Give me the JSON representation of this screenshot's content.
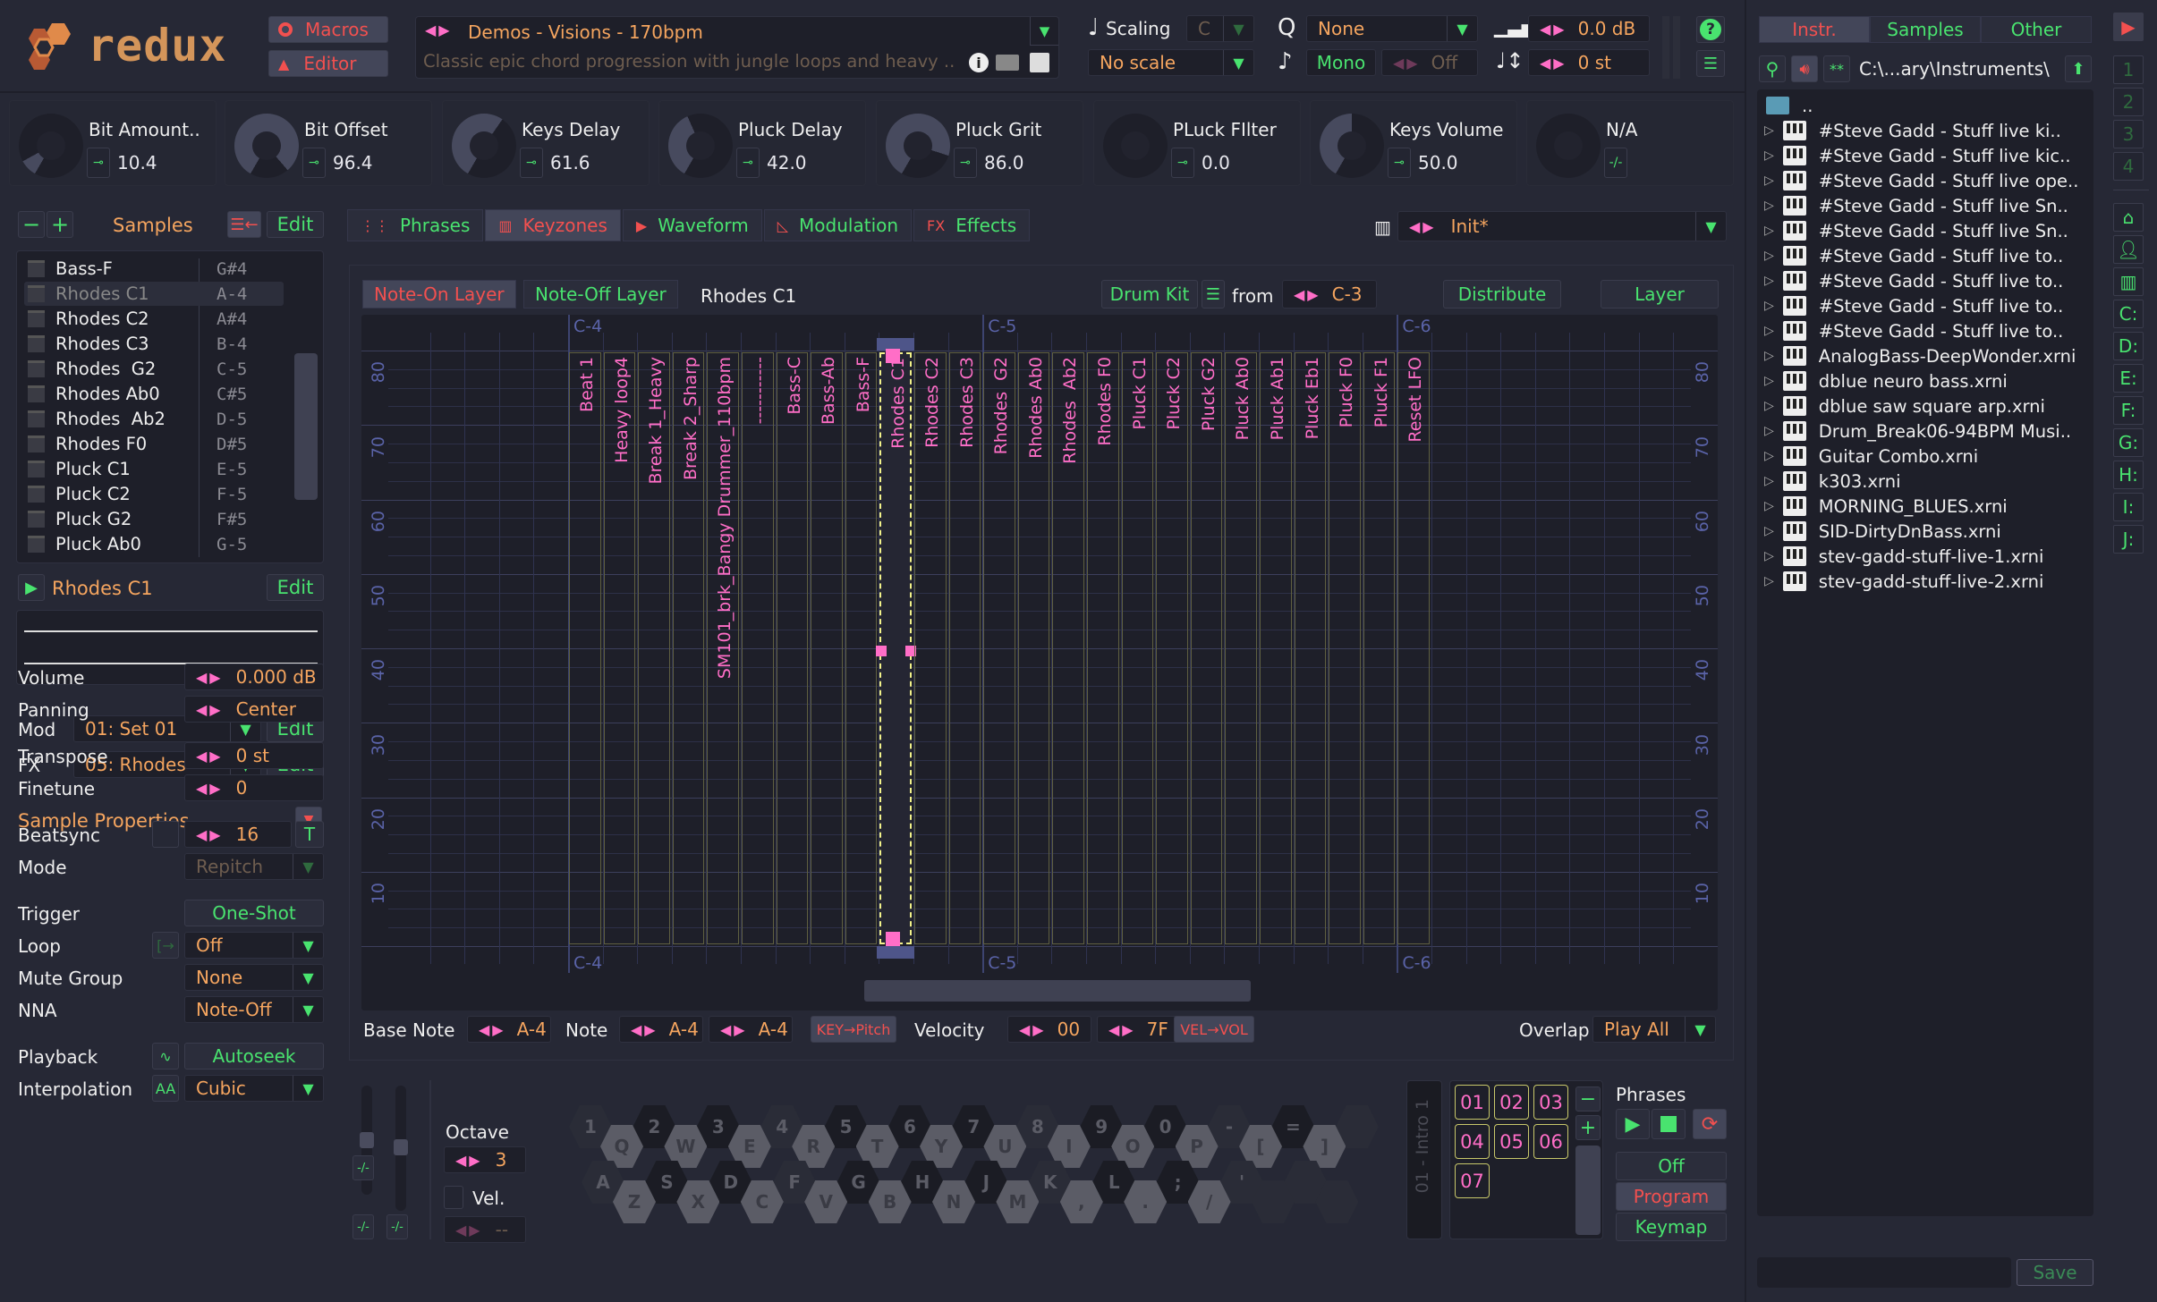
{
  "app": {
    "name": "redux"
  },
  "header": {
    "macros_label": "Macros",
    "editor_label": "Editor",
    "preset_name": "Demos - Visions - 170bpm",
    "preset_description": "Classic epic chord progression with jungle loops and heavy ..",
    "scaling_label": "Scaling",
    "scaling_key": "C",
    "scale_value": "No scale",
    "quantize_value": "None",
    "mono_label": "Mono",
    "glide_value": "Off",
    "volume_value": "0.0 dB",
    "transpose_value": "0 st"
  },
  "macros": [
    {
      "name": "Bit Amount..",
      "value": "10.4",
      "level": 0.104
    },
    {
      "name": "Bit Offset",
      "value": "96.4",
      "level": 0.964
    },
    {
      "name": "Keys Delay",
      "value": "61.6",
      "level": 0.616
    },
    {
      "name": "Pluck Delay",
      "value": "42.0",
      "level": 0.42
    },
    {
      "name": "Pluck Grit",
      "value": "86.0",
      "level": 0.86
    },
    {
      "name": "PLuck FIlter",
      "value": "0.0",
      "level": 0.0
    },
    {
      "name": "Keys Volume",
      "value": "50.0",
      "level": 0.5
    },
    {
      "name": "N/A",
      "value": "",
      "level": 0.0
    }
  ],
  "samples_panel": {
    "title": "Samples",
    "edit_label": "Edit",
    "items": [
      {
        "name": "Bass-F",
        "note": "G#4"
      },
      {
        "name": "Rhodes C1",
        "note": "A-4",
        "selected": true
      },
      {
        "name": "Rhodes C2",
        "note": "A#4"
      },
      {
        "name": "Rhodes C3",
        "note": "B-4"
      },
      {
        "name": "Rhodes  G2",
        "note": "C-5"
      },
      {
        "name": "Rhodes Ab0",
        "note": "C#5"
      },
      {
        "name": "Rhodes  Ab2",
        "note": "D-5"
      },
      {
        "name": "Rhodes F0",
        "note": "D#5"
      },
      {
        "name": "Pluck C1",
        "note": "E-5"
      },
      {
        "name": "Pluck C2",
        "note": "F-5"
      },
      {
        "name": "Pluck G2",
        "note": "F#5"
      },
      {
        "name": "Pluck Ab0",
        "note": "G-5"
      }
    ],
    "current_sample": "Rhodes C1",
    "mod_label": "Mod",
    "mod_value": "01: Set 01",
    "fx_label": "FX",
    "fx_value": "05: Rhodes"
  },
  "sample_properties": {
    "title": "Sample Properties",
    "volume": {
      "label": "Volume",
      "value": "0.000 dB"
    },
    "panning": {
      "label": "Panning",
      "value": "Center"
    },
    "transpose": {
      "label": "Transpose",
      "value": "0 st"
    },
    "finetune": {
      "label": "Finetune",
      "value": "0"
    },
    "beatsync": {
      "label": "Beatsync",
      "value": "16",
      "toggle": "T"
    },
    "mode": {
      "label": "Mode",
      "value": "Repitch"
    },
    "trigger": {
      "label": "Trigger",
      "value": "One-Shot"
    },
    "loop": {
      "label": "Loop",
      "value": "Off"
    },
    "mute_group": {
      "label": "Mute Group",
      "value": "None"
    },
    "nna": {
      "label": "NNA",
      "value": "Note-Off"
    },
    "playback": {
      "label": "Playback",
      "value": "Autoseek"
    },
    "interpolation": {
      "label": "Interpolation",
      "value": "Cubic"
    }
  },
  "main_tabs": [
    {
      "label": "Phrases"
    },
    {
      "label": "Keyzones",
      "active": true
    },
    {
      "label": "Waveform"
    },
    {
      "label": "Modulation"
    },
    {
      "label": "Effects"
    }
  ],
  "preset_selector": {
    "value": "Init*"
  },
  "keyzones": {
    "note_on_layer": "Note-On Layer",
    "note_off_layer": "Note-Off Layer",
    "selected_sample": "Rhodes C1",
    "drum_kit_label": "Drum Kit",
    "from_label": "from",
    "from_value": "C-3",
    "distribute_label": "Distribute",
    "layer_label": "Layer",
    "octave_labels": [
      "C-4",
      "C-5",
      "C-6"
    ],
    "velocity_ticks": [
      "80",
      "70",
      "60",
      "50",
      "40",
      "30",
      "20",
      "10"
    ],
    "zones": [
      "Beat 1",
      "Heavy loop4",
      "Break 1_Heavy",
      "Break 2_Sharp",
      "SM101_brk_Bangy Drummer_110bpm",
      "-----------",
      "Bass-C",
      "Bass-Ab",
      "Bass-F",
      "Rhodes C1",
      "Rhodes C2",
      "Rhodes C3",
      "Rhodes  G2",
      "Rhodes Ab0",
      "Rhodes  Ab2",
      "Rhodes F0",
      "Pluck C1",
      "Pluck C2",
      "Pluck G2",
      "Pluck Ab0",
      "Pluck Ab1",
      "Pluck Eb1",
      "Pluck F0",
      "Pluck F1",
      "Reset LFO"
    ],
    "selected_zone_index": 9,
    "base_note_label": "Base Note",
    "base_note": "A-4",
    "note_label": "Note",
    "note_low": "A-4",
    "note_high": "A-4",
    "key_pitch_label": "KEY→Pitch",
    "velocity_label": "Velocity",
    "vel_low": "00",
    "vel_high": "7F",
    "vel_vol_label": "VEL→VOL",
    "overlap_label": "Overlap",
    "overlap_value": "Play All"
  },
  "keyboard": {
    "octave_label": "Octave",
    "octave_value": "3",
    "vel_label": "Vel.",
    "vel_value": "--",
    "top_row": [
      "1",
      "2",
      "3",
      "4",
      "5",
      "6",
      "7",
      "8",
      "9",
      "0",
      "-",
      "=",
      ""
    ],
    "q_row": [
      "Q",
      "W",
      "E",
      "R",
      "T",
      "Y",
      "U",
      "I",
      "O",
      "P",
      "[",
      "]"
    ],
    "a_row": [
      "A",
      "S",
      "D",
      "F",
      "G",
      "H",
      "J",
      "K",
      "L",
      ";",
      "'",
      ""
    ],
    "z_row": [
      "Z",
      "X",
      "C",
      "V",
      "B",
      "N",
      "M",
      ",",
      ".",
      "/",
      "",
      ""
    ]
  },
  "phrases": {
    "title": "Phrases",
    "current_phrase": "01 - Intro 1",
    "slots": [
      "01",
      "02",
      "03",
      "04",
      "05",
      "06",
      "07"
    ],
    "mode_off": "Off",
    "mode_program": "Program",
    "mode_keymap": "Keymap"
  },
  "browser": {
    "tabs": [
      {
        "label": "Instr.",
        "active": true
      },
      {
        "label": "Samples"
      },
      {
        "label": "Other"
      }
    ],
    "path": "C:\\...ary\\Instruments\\",
    "parent": "..",
    "files": [
      "#Steve Gadd - Stuff live ki..",
      "#Steve Gadd - Stuff live kic..",
      "#Steve Gadd - Stuff live ope..",
      "#Steve Gadd - Stuff live Sn..",
      "#Steve Gadd - Stuff live Sn..",
      "#Steve Gadd - Stuff live to..",
      "#Steve Gadd - Stuff live to..",
      "#Steve Gadd - Stuff live to..",
      "#Steve Gadd - Stuff live to..",
      "AnalogBass-DeepWonder.xrni",
      "dblue neuro bass.xrni",
      "dblue saw square arp.xrni",
      "Drum_Break06-94BPM Musi..",
      "Guitar Combo.xrni",
      "k303.xrni",
      "MORNING_BLUES.xrni",
      "SID-DirtyDnBass.xrni",
      "stev-gadd-stuff-live-1.xrni",
      "stev-gadd-stuff-live-2.xrni"
    ],
    "save_label": "Save",
    "filename_value": ""
  },
  "side_nav": [
    "1",
    "2",
    "3",
    "4",
    "home",
    "user",
    "library",
    "C:",
    "D:",
    "E:",
    "F:",
    "G:",
    "H:",
    "I:",
    "J:"
  ]
}
